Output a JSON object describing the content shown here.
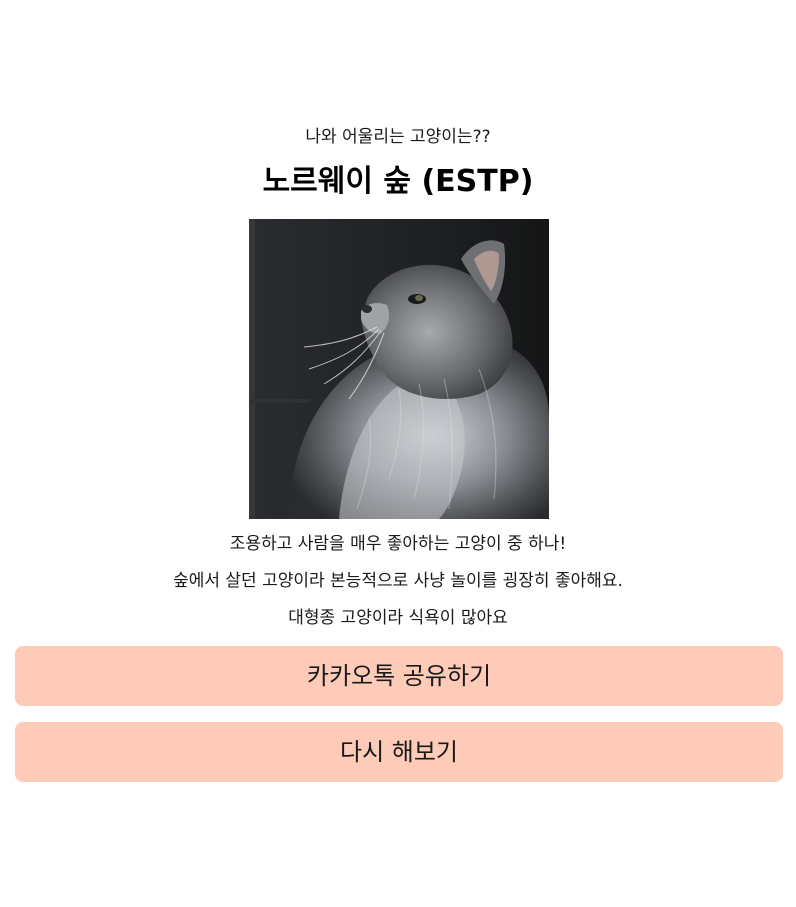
{
  "result": {
    "subtitle": "나와 어울리는 고양이는??",
    "title": "노르웨이 숲 (ESTP)",
    "image_alt": "노르웨이 숲",
    "descriptions": [
      "조용하고 사람을 매우 좋아하는 고양이 중 하나!",
      "숲에서 살던 고양이라 본능적으로 사냥 놀이를 굉장히 좋아해요.",
      "대형종 고양이라 식욕이 많아요"
    ]
  },
  "actions": {
    "share_label": "카카오톡 공유하기",
    "retry_label": "다시 해보기"
  },
  "colors": {
    "button_bg": "#fecbb8",
    "background": "#ffffff",
    "text": "#111111"
  }
}
